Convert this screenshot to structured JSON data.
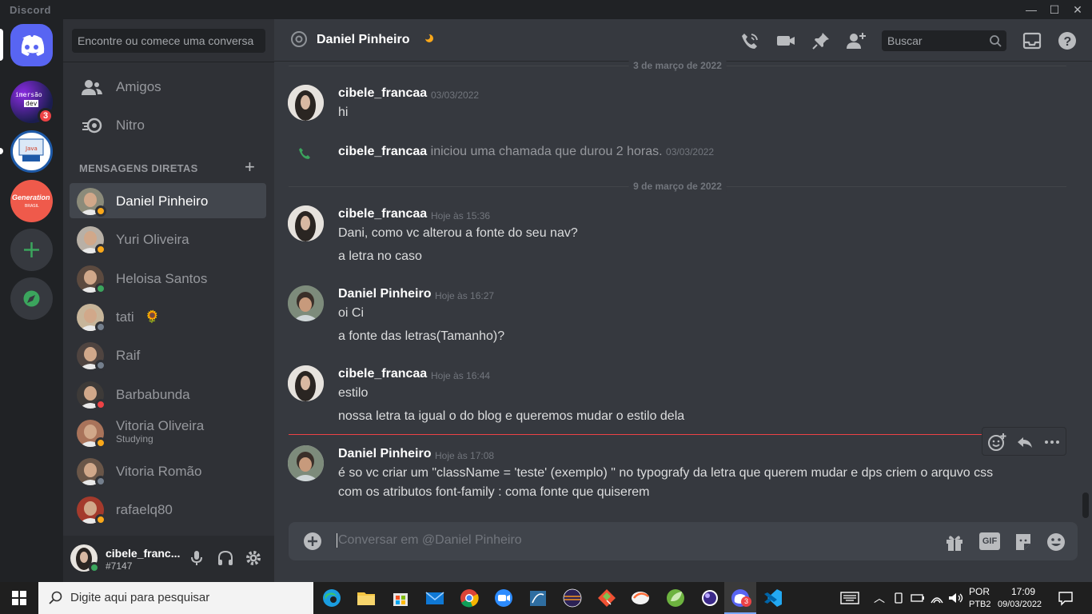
{
  "app": {
    "title": "Discord"
  },
  "window_controls": {
    "minimize": "—",
    "maximize": "☐",
    "close": "✕"
  },
  "servers": [
    {
      "name": "home",
      "badge": ""
    },
    {
      "name": "imersao-dev",
      "icon_text_1": "imersão",
      "icon_text_2": "dev",
      "badge": "3"
    },
    {
      "name": "java-server",
      "badge": ""
    },
    {
      "name": "generation-brasil",
      "icon_text_1": "Generation",
      "icon_text_2": "BRASIL",
      "badge": ""
    },
    {
      "name": "add-server",
      "badge": ""
    },
    {
      "name": "explore",
      "badge": ""
    }
  ],
  "sidebar": {
    "search_placeholder": "Encontre ou comece uma conversa",
    "nav": [
      {
        "label": "Amigos",
        "icon": "friends-icon"
      },
      {
        "label": "Nitro",
        "icon": "nitro-icon"
      }
    ],
    "dm_header": "MENSAGENS DIRETAS",
    "dm_add": "+",
    "dms": [
      {
        "name": "Daniel Pinheiro",
        "status": "idle",
        "sub": "",
        "active": true,
        "emoji": ""
      },
      {
        "name": "Yuri Oliveira",
        "status": "idle",
        "sub": "",
        "active": false,
        "emoji": ""
      },
      {
        "name": "Heloisa Santos",
        "status": "online",
        "sub": "",
        "active": false,
        "emoji": ""
      },
      {
        "name": "tati",
        "status": "offline",
        "sub": "",
        "active": false,
        "emoji": "🌻"
      },
      {
        "name": "Raif",
        "status": "offline",
        "sub": "",
        "active": false,
        "emoji": ""
      },
      {
        "name": "Barbabunda",
        "status": "dnd",
        "sub": "",
        "active": false,
        "emoji": ""
      },
      {
        "name": "Vitoria Oliveira",
        "status": "idle",
        "sub": "Studying",
        "active": false,
        "emoji": ""
      },
      {
        "name": "Vitoria Romão",
        "status": "offline",
        "sub": "",
        "active": false,
        "emoji": ""
      },
      {
        "name": "rafaelq80",
        "status": "idle",
        "sub": "",
        "active": false,
        "emoji": ""
      }
    ]
  },
  "user_panel": {
    "name": "cibele_franc...",
    "tag": "#7147"
  },
  "header": {
    "title": "Daniel Pinheiro",
    "search_placeholder": "Buscar"
  },
  "messages": {
    "sep1": "3 de março de 2022",
    "m1": {
      "author": "cibele_francaa",
      "time": "03/03/2022",
      "lines": [
        "hi"
      ]
    },
    "call": {
      "author": "cibele_francaa",
      "text": " iniciou uma chamada que durou 2 horas. ",
      "time": "03/03/2022"
    },
    "sep2": "9 de março de 2022",
    "m2": {
      "author": "cibele_francaa",
      "time": "Hoje às 15:36",
      "lines": [
        "Dani, como vc alterou a fonte do seu nav?",
        "a letra no caso"
      ]
    },
    "m3": {
      "author": "Daniel Pinheiro",
      "time": "Hoje às 16:27",
      "lines": [
        "oi Ci",
        "a fonte das letras(Tamanho)?"
      ]
    },
    "m4": {
      "author": "cibele_francaa",
      "time": "Hoje às 16:44",
      "lines": [
        "estilo",
        "nossa letra ta igual o do blog e queremos mudar o estilo dela"
      ]
    },
    "m5": {
      "author": "Daniel Pinheiro",
      "time": "Hoje às 17:08",
      "lines": [
        "é so vc criar um \"className = 'teste' (exemplo) \" no typografy da letra que querem mudar e dps criem o arquvo css",
        "com os atributos  font-family : coma fonte que quiserem"
      ]
    }
  },
  "composer": {
    "placeholder": "Conversar em @Daniel Pinheiro",
    "gif_label": "GIF"
  },
  "taskbar": {
    "search_placeholder": "Digite aqui para pesquisar",
    "discord_badge": "3",
    "lang1": "POR",
    "lang2": "PTB2",
    "time": "17:09",
    "date": "09/03/2022"
  },
  "colors": {
    "blurple": "#5865f2",
    "online": "#3ba55d",
    "idle": "#faa81a",
    "dnd": "#ed4245",
    "offline": "#747f8d",
    "call_green": "#3ba55d"
  }
}
